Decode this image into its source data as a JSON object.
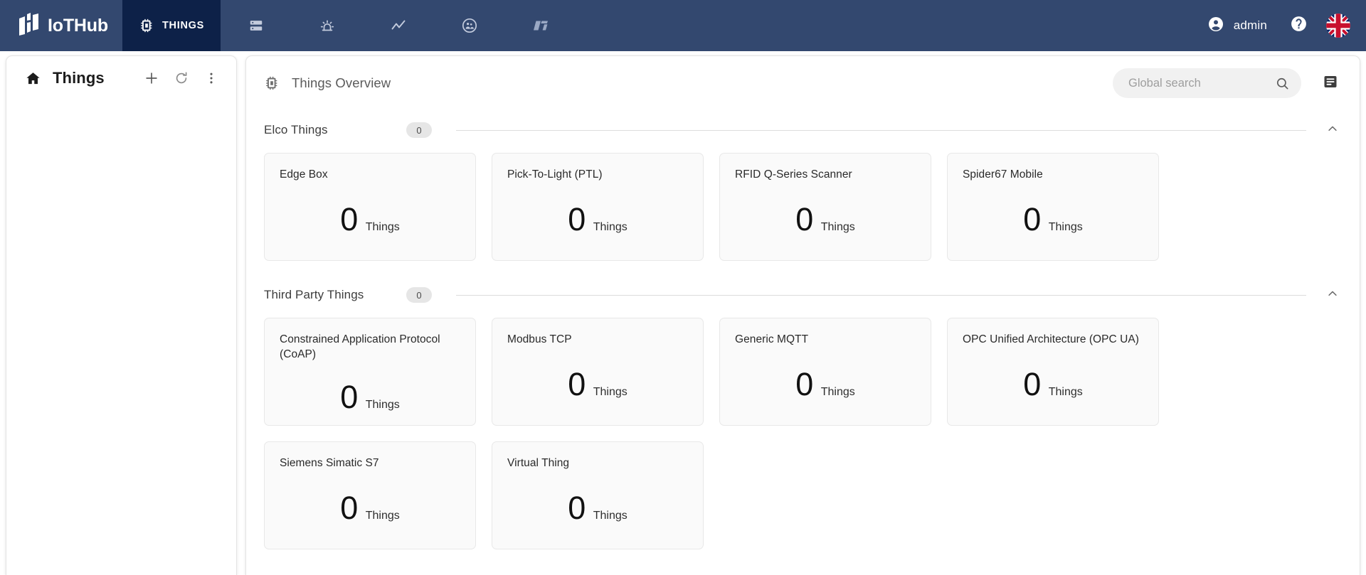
{
  "app": {
    "brand": "IoTHub",
    "header_bg": "#33486f",
    "active_tab_bg": "#0d2148",
    "accent": "#ffffff"
  },
  "topnav": {
    "tabs": [
      {
        "label": "THINGS",
        "icon": "chip-icon",
        "active": true
      },
      {
        "label": "",
        "icon": "server-rack-icon",
        "active": false
      },
      {
        "label": "",
        "icon": "alarm-light-icon",
        "active": false
      },
      {
        "label": "",
        "icon": "trending-line-icon",
        "active": false
      },
      {
        "label": "",
        "icon": "people-group-icon",
        "active": false
      },
      {
        "label": "",
        "icon": "lightning-lt-icon",
        "active": false
      }
    ],
    "account": {
      "label": "admin",
      "icon": "account-circle-icon"
    },
    "help": {
      "icon": "help-circle-icon"
    },
    "language": {
      "icon": "uk-flag-icon",
      "value": "EN"
    }
  },
  "sidebar": {
    "home_icon": "home-icon",
    "title": "Things",
    "actions": [
      {
        "name": "add-button",
        "icon": "plus-icon"
      },
      {
        "name": "refresh-button",
        "icon": "refresh-icon"
      },
      {
        "name": "more-options-button",
        "icon": "more-vert-icon"
      }
    ]
  },
  "main": {
    "icon": "chip-icon",
    "title": "Things Overview",
    "search": {
      "placeholder": "Global search",
      "value": "",
      "icon": "search-icon"
    },
    "list_view_button": {
      "icon": "list-view-icon"
    },
    "sections": [
      {
        "title": "Elco Things",
        "badge": "0",
        "collapse_icon": "chevron-up-icon",
        "cards": [
          {
            "title": "Edge Box",
            "count": "0",
            "unit": "Things"
          },
          {
            "title": "Pick-To-Light (PTL)",
            "count": "0",
            "unit": "Things"
          },
          {
            "title": "RFID Q-Series Scanner",
            "count": "0",
            "unit": "Things"
          },
          {
            "title": "Spider67 Mobile",
            "count": "0",
            "unit": "Things"
          }
        ]
      },
      {
        "title": "Third Party Things",
        "badge": "0",
        "collapse_icon": "chevron-up-icon",
        "cards": [
          {
            "title": "Constrained Application Protocol (CoAP)",
            "count": "0",
            "unit": "Things",
            "tall": true
          },
          {
            "title": "Modbus TCP",
            "count": "0",
            "unit": "Things"
          },
          {
            "title": "Generic MQTT",
            "count": "0",
            "unit": "Things"
          },
          {
            "title": "OPC Unified Architecture (OPC UA)",
            "count": "0",
            "unit": "Things"
          },
          {
            "title": "Siemens Simatic S7",
            "count": "0",
            "unit": "Things"
          },
          {
            "title": "Virtual Thing",
            "count": "0",
            "unit": "Things"
          }
        ]
      }
    ]
  }
}
